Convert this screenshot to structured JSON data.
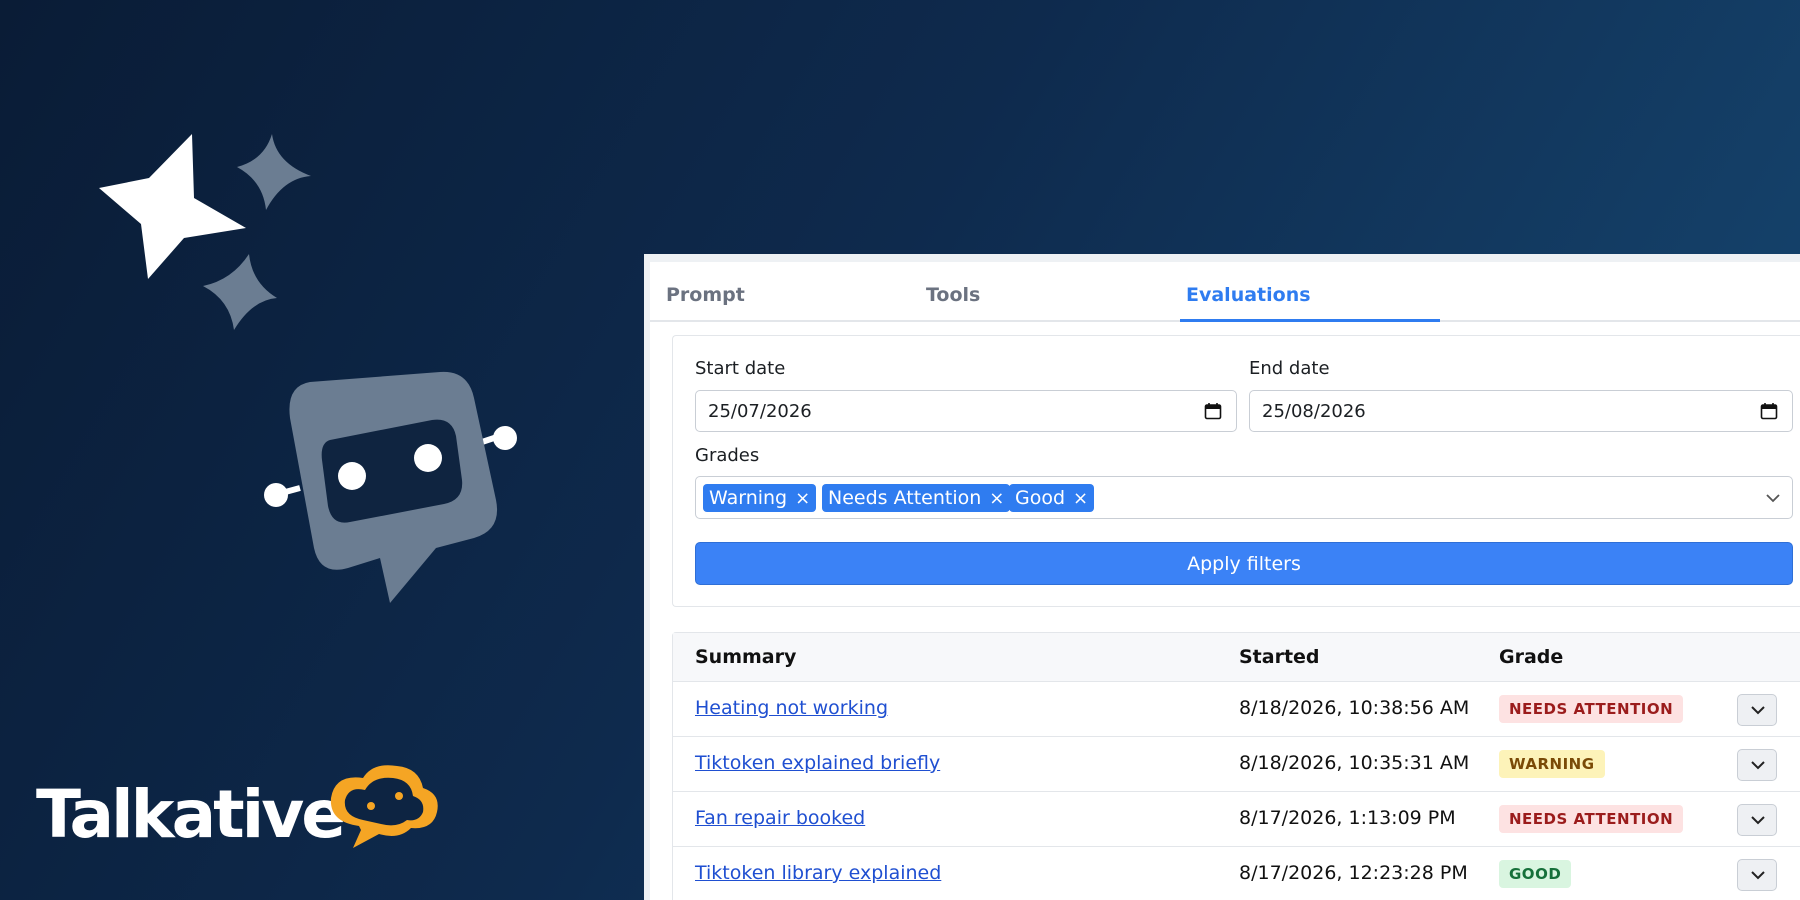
{
  "brand": {
    "name": "Talkative"
  },
  "tabs": [
    {
      "label": "Prompt",
      "active": false
    },
    {
      "label": "Tools",
      "active": false
    },
    {
      "label": "Evaluations",
      "active": true
    }
  ],
  "filters": {
    "start_date": {
      "label": "Start date",
      "value": "25/07/2026"
    },
    "end_date": {
      "label": "End date",
      "value": "25/08/2026"
    },
    "grades": {
      "label": "Grades",
      "selected": [
        "Warning",
        "Needs Attention",
        "Good"
      ],
      "remove_glyph": "×"
    },
    "apply_label": "Apply filters"
  },
  "table": {
    "columns": {
      "summary": "Summary",
      "started": "Started",
      "grade": "Grade"
    },
    "rows": [
      {
        "summary": "Heating not working",
        "started": "8/18/2026, 10:38:56 AM",
        "grade": "NEEDS ATTENTION"
      },
      {
        "summary": "Tiktoken explained briefly",
        "started": "8/18/2026, 10:35:31 AM",
        "grade": "WARNING"
      },
      {
        "summary": "Fan repair booked",
        "started": "8/17/2026, 1:13:09 PM",
        "grade": "NEEDS ATTENTION"
      },
      {
        "summary": "Tiktoken library explained",
        "started": "8/17/2026, 12:23:28 PM",
        "grade": "GOOD"
      }
    ]
  },
  "colors": {
    "accent": "#2f7cf0",
    "apply_button": "#3b82f6",
    "link": "#1f4fd1",
    "brand_bubble": "#f5a524",
    "grade_needs_attention_bg": "#fde2e2",
    "grade_warning_bg": "#fdf3b9",
    "grade_good_bg": "#d9f5e0"
  },
  "icons": [
    "sparkle-icon",
    "robot-chat-icon",
    "calendar-icon",
    "chevron-down-icon",
    "close-icon"
  ]
}
